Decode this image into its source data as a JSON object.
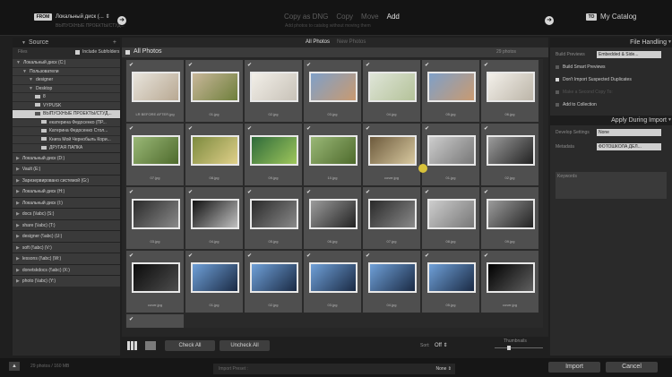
{
  "header": {
    "from_badge": "FROM",
    "source": "Локальный диск (...",
    "source_sub": "ВЫПУСКНЫЕ ПРОЕКТЫ/СТУД...",
    "modes": [
      {
        "label": "Copy as DNG",
        "active": false
      },
      {
        "label": "Copy",
        "active": false
      },
      {
        "label": "Move",
        "active": false
      },
      {
        "label": "Add",
        "active": true
      }
    ],
    "mode_description": "Add photos to catalog without moving them",
    "to_badge": "TO",
    "destination": "My Catalog"
  },
  "source_panel": {
    "title": "Source",
    "files_label": "Files",
    "include_subfolders": "Include Subfolders",
    "tree": [
      {
        "label": "Локальный диск (C:)",
        "indent": 0,
        "type": "drive",
        "selected": false
      },
      {
        "label": "Пользователи",
        "indent": 1,
        "type": "item",
        "selected": false
      },
      {
        "label": "designer",
        "indent": 2,
        "type": "item",
        "selected": false
      },
      {
        "label": "Desktop",
        "indent": 2,
        "type": "item",
        "selected": false
      },
      {
        "label": "8",
        "indent": 3,
        "type": "folder",
        "selected": false
      },
      {
        "label": "VYPUSK",
        "indent": 3,
        "type": "folder",
        "selected": false
      },
      {
        "label": "ВЫПУСКНЫЕ ПРОЕКТЫ/СТУД...",
        "indent": 3,
        "type": "folder",
        "selected": true
      },
      {
        "label": "екатерина Федосенко (ПР...",
        "indent": 4,
        "type": "folder",
        "selected": false
      },
      {
        "label": "Катерина Федосенко Стол...",
        "indent": 4,
        "type": "folder",
        "selected": false
      },
      {
        "label": "Книга Мой Чернобыль Кори...",
        "indent": 4,
        "type": "folder",
        "selected": false
      },
      {
        "label": "ДРУГАЯ ПАПКА",
        "indent": 4,
        "type": "folder",
        "selected": false
      }
    ],
    "volumes": [
      "Локальный диск (D:)",
      "Vault (E:)",
      "Зарезервировано системой (G:)",
      "Локальный диск (H:)",
      "Локальный диск (I:)",
      "docs (\\\\abc) (S:)",
      "share (\\\\abc) (T:)",
      "designer (\\\\abc) (U:)",
      "soft (\\\\abc) (V:)",
      "lessons (\\\\abc) (W:)",
      "donetskdocs (\\\\abc) (X:)",
      "photo (\\\\abc) (Y:)"
    ]
  },
  "center": {
    "tabs": {
      "all_photos": "All Photos",
      "new_photos": "New Photos"
    },
    "grid_title": "All Photos",
    "photo_count": "29 photos",
    "check_mark": "✔",
    "photos": [
      {
        "name": "LR BEFORE AFTER.jpg",
        "tint": 0
      },
      {
        "name": "01.jpg",
        "tint": 1
      },
      {
        "name": "02.jpg",
        "tint": 2
      },
      {
        "name": "03.jpg",
        "tint": 3
      },
      {
        "name": "04.jpg",
        "tint": 4
      },
      {
        "name": "05.jpg",
        "tint": 3
      },
      {
        "name": "06.jpg",
        "tint": 5
      },
      {
        "name": "07.jpg",
        "tint": 6
      },
      {
        "name": "08.jpg",
        "tint": 7
      },
      {
        "name": "09.jpg",
        "tint": 8
      },
      {
        "name": "10.jpg",
        "tint": 6
      },
      {
        "name": "cover.jpg",
        "tint": 9
      },
      {
        "name": "01.jpg",
        "tint": 10
      },
      {
        "name": "02.jpg",
        "tint": 11
      },
      {
        "name": "03.jpg",
        "tint": 12
      },
      {
        "name": "04.jpg",
        "tint": 13
      },
      {
        "name": "05.jpg",
        "tint": 12
      },
      {
        "name": "06.jpg",
        "tint": 11
      },
      {
        "name": "07.jpg",
        "tint": 12
      },
      {
        "name": "08.jpg",
        "tint": 10
      },
      {
        "name": "09.jpg",
        "tint": 11
      },
      {
        "name": "cover.jpg",
        "tint": 14
      },
      {
        "name": "01.jpg",
        "tint": 15
      },
      {
        "name": "02.jpg",
        "tint": 15
      },
      {
        "name": "03.jpg",
        "tint": 15
      },
      {
        "name": "04.jpg",
        "tint": 15
      },
      {
        "name": "05.jpg",
        "tint": 15
      },
      {
        "name": "cover.jpg",
        "tint": 16
      },
      {
        "name": "",
        "tint": -1
      }
    ],
    "footer": {
      "check_all": "Check All",
      "uncheck_all": "Uncheck All",
      "sort_label": "Sort:",
      "sort_value": "Off ⇕",
      "thumbnails_label": "Thumbnails",
      "thumbnail_size": 0.3
    }
  },
  "right_panel": {
    "file_handling": {
      "title": "File Handling",
      "build_previews_label": "Build Previews",
      "build_previews_value": "Embedded & Side...",
      "options": [
        {
          "label": "Build Smart Previews",
          "checked": false,
          "dim": false
        },
        {
          "label": "Don't Import Suspected Duplicates",
          "checked": true,
          "dim": false
        },
        {
          "label": "Make a Second Copy To:",
          "checked": false,
          "dim": true
        },
        {
          "label": "Add to Collection",
          "checked": false,
          "dim": false
        }
      ]
    },
    "apply_during_import": {
      "title": "Apply During Import",
      "develop_settings_label": "Develop Settings",
      "develop_settings_value": "None",
      "metadata_label": "Metadata",
      "metadata_value": "ФОТОШКОЛА ДЕЛ...",
      "keywords_label": "Keywords"
    }
  },
  "bottom": {
    "info": "29 photos / 160 MB",
    "import_preset_label": "Import Preset :",
    "import_preset_value": "None ⇕",
    "import_button": "Import",
    "cancel_button": "Cancel"
  }
}
